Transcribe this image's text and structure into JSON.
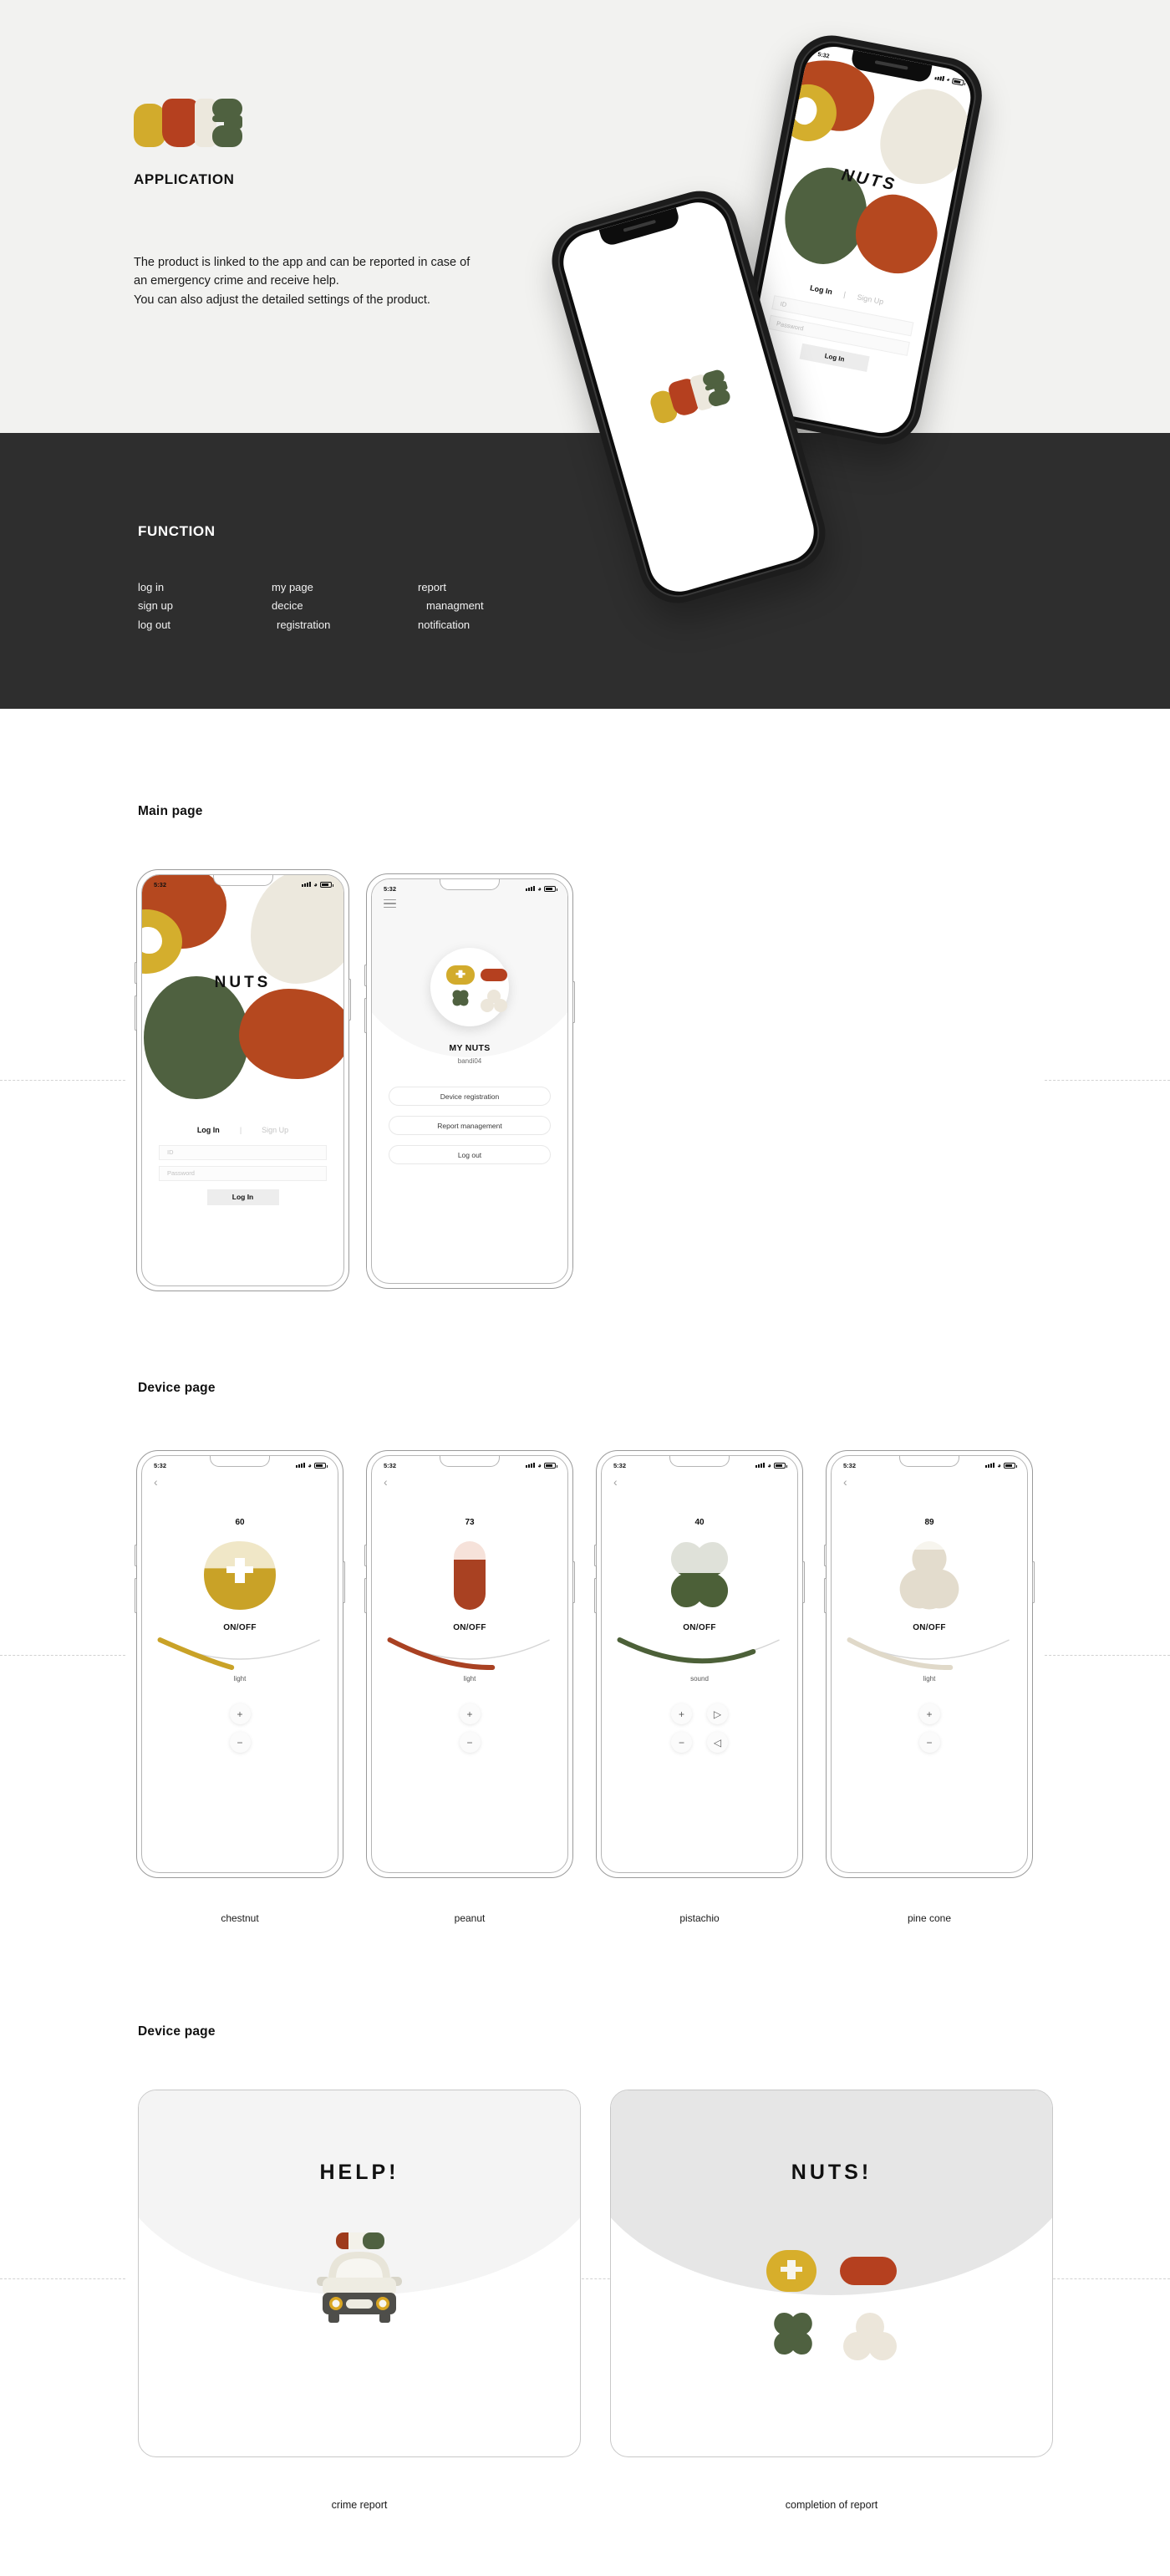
{
  "hero": {
    "logo_name": "nuts-logo",
    "heading": "APPLICATION",
    "description": "The product is linked to the app and can be reported in case of\nan emergency crime and receive help.\nYou can also adjust the detailed settings of the product."
  },
  "function_section": {
    "heading": "FUNCTION",
    "columns": [
      {
        "items": [
          "log in",
          "sign up",
          "log out"
        ]
      },
      {
        "items": [
          "my page",
          "decice",
          "registration"
        ]
      },
      {
        "items": [
          "report",
          "managment",
          "notification"
        ]
      }
    ]
  },
  "hero_phones": {
    "status": {
      "time": "5:32"
    },
    "brand": "NUTS",
    "tabs": {
      "login": "Log In",
      "separator": "|",
      "signup": "Sign Up"
    },
    "fields": {
      "id_placeholder": "ID",
      "password_placeholder": "Password"
    },
    "submit": "Log In"
  },
  "main_page": {
    "title": "Main page",
    "login_phone": {
      "status": {
        "time": "5:32"
      },
      "brand": "NUTS",
      "tabs": {
        "login": "Log In",
        "separator": "|",
        "signup": "Sign Up"
      },
      "fields": {
        "id_placeholder": "ID",
        "password_placeholder": "Password"
      },
      "submit": "Log In"
    },
    "profile_phone": {
      "status": {
        "time": "5:32"
      },
      "title": "MY NUTS",
      "username": "bandi04",
      "buttons": [
        "Device registration",
        "Report management",
        "Log out"
      ]
    }
  },
  "device_page": {
    "title": "Device page",
    "devices": [
      {
        "caption": "chestnut",
        "status_time": "5:32",
        "value": "60",
        "toggle_label": "ON/OFF",
        "slider_label": "light",
        "slider_percent": 60,
        "color": "#c9a227",
        "light_color": "#f0e7c7",
        "pads": [
          "+",
          "−"
        ],
        "shape": "chestnut"
      },
      {
        "caption": "peanut",
        "status_time": "5:32",
        "value": "73",
        "toggle_label": "ON/OFF",
        "slider_label": "light",
        "slider_percent": 73,
        "color": "#a94122",
        "light_color": "#f6e2da",
        "pads": [
          "+",
          "−"
        ],
        "shape": "peanut"
      },
      {
        "caption": "pistachio",
        "status_time": "5:32",
        "value": "40",
        "toggle_label": "ON/OFF",
        "slider_label": "sound",
        "slider_percent": 85,
        "color": "#4c6038",
        "light_color": "#dfe1d9",
        "pads": [
          "+",
          "−",
          "▷",
          "◁"
        ],
        "shape": "pistachio"
      },
      {
        "caption": "pine cone",
        "status_time": "5:32",
        "value": "89",
        "toggle_label": "ON/OFF",
        "slider_label": "light",
        "slider_percent": 68,
        "color": "#e3dccd",
        "light_color": "#f7f5ee",
        "pads": [
          "+",
          "−"
        ],
        "shape": "pinecone"
      }
    ]
  },
  "report_page": {
    "title": "Device page",
    "cards": [
      {
        "title": "HELP!",
        "caption": "crime report",
        "bg": "#f4f4f4",
        "icon": "police-car"
      },
      {
        "title": "NUTS!",
        "caption": "completion of report",
        "bg": "#e6e6e6",
        "icon": "nut-shapes"
      }
    ]
  },
  "colors": {
    "yellow": "#d2ab2c",
    "red": "#b5401f",
    "cream": "#ece8dd",
    "green": "#4f6140",
    "dark_band": "#2e2e2e",
    "hero_bg": "#f2f2f0"
  }
}
